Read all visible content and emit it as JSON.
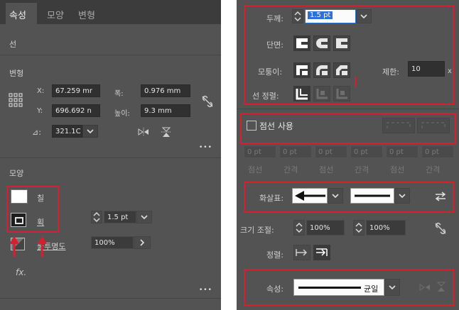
{
  "left": {
    "tabs": [
      "속성",
      "모양",
      "변형"
    ],
    "section_line": "선",
    "section_transform": "변형",
    "x_label": "X:",
    "x_value": "67.259 mr",
    "w_label": "폭:",
    "w_value": "0.976 mm",
    "y_label": "Y:",
    "y_value": "696.692 n",
    "h_label": "높이:",
    "h_value": "9.3 mm",
    "angle_label": "⊿:",
    "angle_value": "321.1C",
    "more": "•••",
    "section_appearance": "모양",
    "fill_label": "칠",
    "stroke_label": "획",
    "stroke_weight": "1.5 pt",
    "opacity_label": "불투명도",
    "opacity_value": "100%",
    "fx_label": "fx.",
    "more2": "•••"
  },
  "right": {
    "weight_label": "두께:",
    "weight_value": "1.5 pt",
    "cap_label": "단면:",
    "corner_label": "모퉁이:",
    "limit_label": "제한:",
    "limit_value": "10",
    "limit_suffix": "x",
    "align_label": "선 정렬:",
    "dash_label": "점선 사용",
    "dash_values": [
      "0 pt",
      "0 pt",
      "0 pt",
      "0 pt",
      "0 pt",
      "0 pt"
    ],
    "dash_labels": [
      "점선",
      "간격",
      "점선",
      "간격",
      "점선",
      "간격"
    ],
    "arrow_label": "화살표:",
    "scale_label": "크기 조절:",
    "scale_start": "100%",
    "scale_end": "100%",
    "arrange_label": "정렬:",
    "profile_label": "속성:",
    "profile_value": "균일"
  },
  "colors": {
    "panel": "#535353",
    "header": "#3c3c3c",
    "highlight_border": "#d71f2e",
    "selection": "#2f6fd6"
  }
}
